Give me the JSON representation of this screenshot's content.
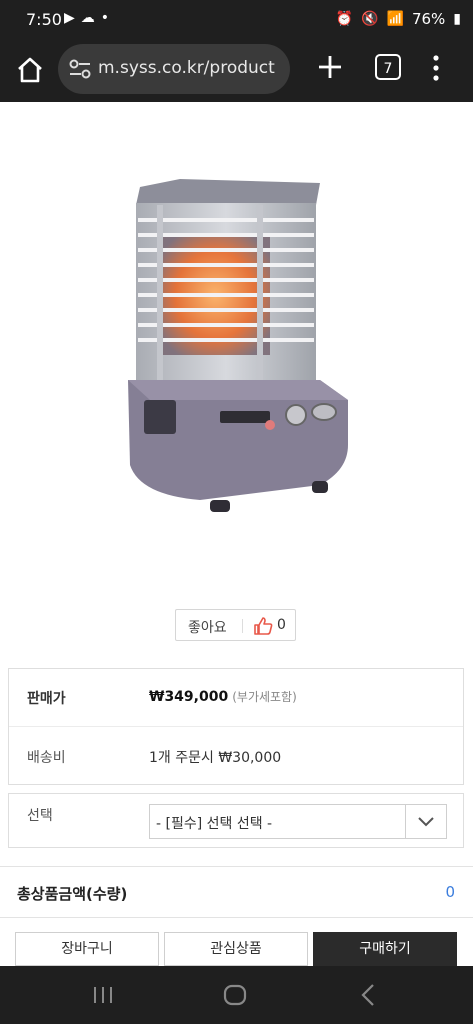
{
  "status_bar": {
    "time": "7:50",
    "battery": "76%"
  },
  "browser": {
    "url": "m.syss.co.kr/product",
    "tab_count": "7"
  },
  "like": {
    "label": "좋아요",
    "count": "0"
  },
  "info": {
    "price_label": "판매가",
    "price_value": "₩349,000",
    "price_note": "(부가세포함)",
    "shipping_label": "배송비",
    "shipping_value": "1개 주문시 ₩30,000"
  },
  "option": {
    "label": "선택",
    "selected": "- [필수] 선택 선택 -"
  },
  "total": {
    "label": "총상품금액(수량)",
    "value": "0"
  },
  "buttons": {
    "cart": "장바구니",
    "wish": "관심상품",
    "buy": "구매하기"
  },
  "colors": {
    "accent": "#3b7ddd",
    "buy_button": "#2b2b2b",
    "system_bar": "#1f1f1f"
  }
}
